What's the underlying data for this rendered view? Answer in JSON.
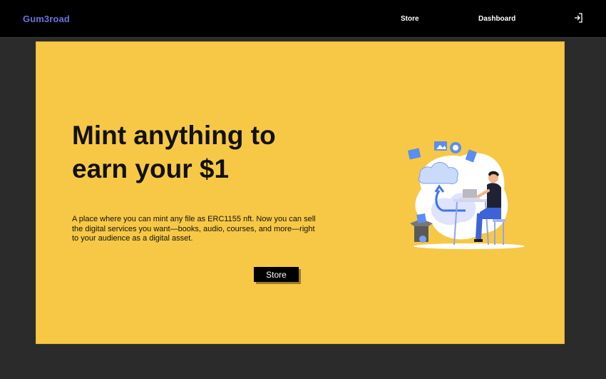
{
  "navbar": {
    "logo": "Gum3road",
    "links": [
      {
        "label": "Store"
      },
      {
        "label": "Dashboard"
      }
    ],
    "login_icon": "login-icon"
  },
  "hero": {
    "title": "Mint anything to earn your $1",
    "description": "A place where you can mint any file as ERC1155 nft. Now you can sell the digital services you want—books, audio, courses, and more—right to your audience as a digital asset.",
    "button_label": "Store",
    "illustration": "person-at-laptop-with-cloud-upload"
  },
  "colors": {
    "background": "#2b2b2b",
    "navbar": "#000000",
    "logo": "#6f6fe0",
    "hero": "#f7c845",
    "accent_blue": "#5a8ef0",
    "button": "#000000"
  }
}
